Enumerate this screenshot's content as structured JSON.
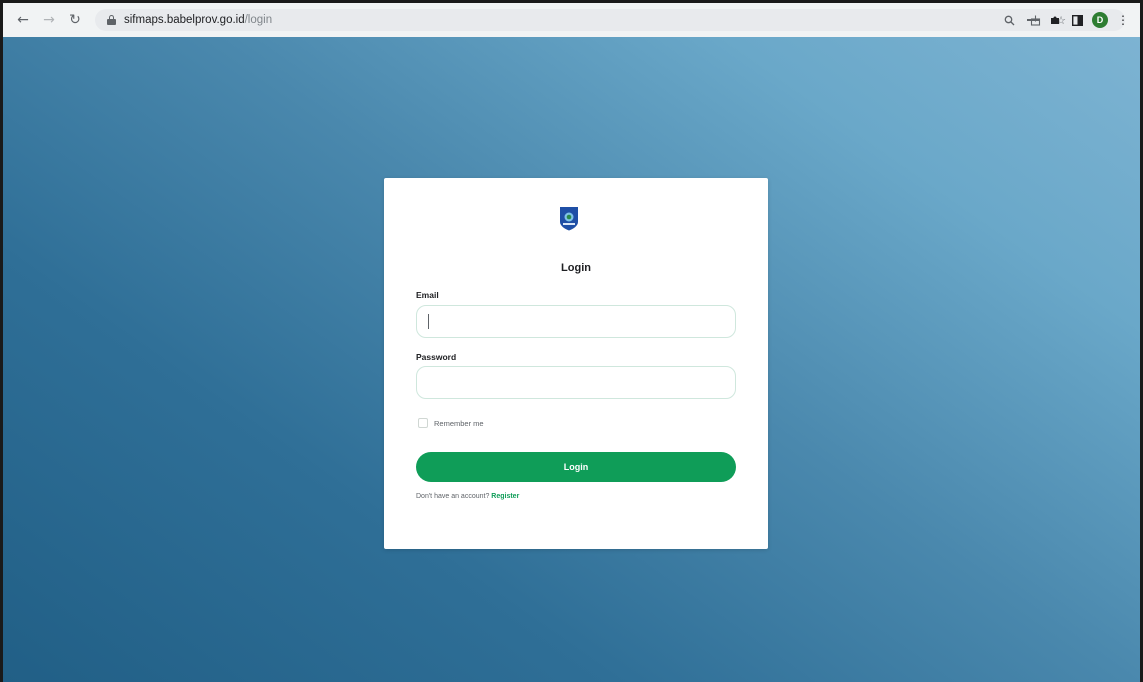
{
  "browser": {
    "back_icon": "back-arrow-icon",
    "forward_icon": "forward-arrow-icon",
    "reload_icon": "reload-icon",
    "url_host": "sifmaps.babelprov.go.id",
    "url_path": "/login",
    "omnibox_icons": [
      "search-icon",
      "share-icon",
      "star-icon"
    ],
    "extension_icons": [
      "extension-icon",
      "puzzle-icon",
      "sidepanel-icon"
    ],
    "profile_initial": "D",
    "menu_icon": "more-vert-icon"
  },
  "login": {
    "title": "Login",
    "email_label": "Email",
    "email_value": "",
    "password_label": "Password",
    "password_value": "",
    "remember_label": "Remember me",
    "remember_checked": false,
    "button_label": "Login",
    "no_account_text": "Don't have an account? ",
    "register_link": "Register"
  },
  "colors": {
    "accent": "#0f9d58",
    "background_start": "#215f86",
    "background_end": "#7db3d2",
    "logo_blue": "#1f4fa6"
  }
}
